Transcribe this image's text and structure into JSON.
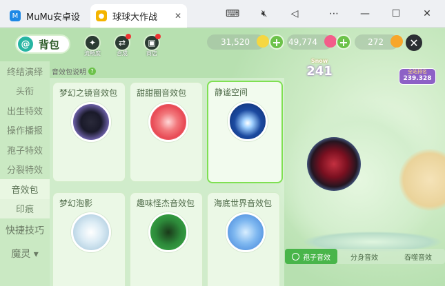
{
  "tabs": [
    {
      "title": "MuMu安卓设",
      "icon": "mumu-logo-icon"
    },
    {
      "title": "球球大作战",
      "icon": "game-logo-icon"
    }
  ],
  "window_controls": [
    "keyboard-icon",
    "mute-icon",
    "back-icon",
    "more-icon",
    "minimize-icon",
    "maximize-icon",
    "close-icon"
  ],
  "back_label": "背包",
  "top_icons": [
    {
      "name": "sparkle",
      "label": "流畅度"
    },
    {
      "name": "shuffle",
      "label": "合成"
    },
    {
      "name": "shop",
      "label": "商店"
    }
  ],
  "currencies": [
    {
      "value": "31,520",
      "color": "#f5d742"
    },
    {
      "value": "49,774",
      "color": "#f35d8a"
    },
    {
      "value": "272",
      "color": "#f7a62a"
    }
  ],
  "badges": {
    "badge1_top": "Snow",
    "badge1_num": "241",
    "badge2_top": "全站排名",
    "badge2_num": "239.328"
  },
  "sidebar": [
    "终结演绎",
    "头衔",
    "出生特效",
    "操作播报",
    "孢子特效",
    "分裂特效",
    "音效包",
    "印痕",
    "快捷技巧",
    "魔灵 ▾"
  ],
  "sidebar_active": "音效包",
  "help_label": "音效包说明",
  "cards": [
    {
      "name": "梦幻之镜音效包",
      "disc": "note"
    },
    {
      "name": "甜甜圈音效包",
      "disc": "donut"
    },
    {
      "name": "静谧空间",
      "disc": "moon"
    },
    {
      "name": "梦幻泡影",
      "disc": "bubble"
    },
    {
      "name": "趣味怪杰音效包",
      "disc": "monster"
    },
    {
      "name": "海底世界音效包",
      "disc": "dolphin"
    }
  ],
  "switch": {
    "on": "孢子音效",
    "off1": "分身音效",
    "off2": "吞噬音效"
  }
}
